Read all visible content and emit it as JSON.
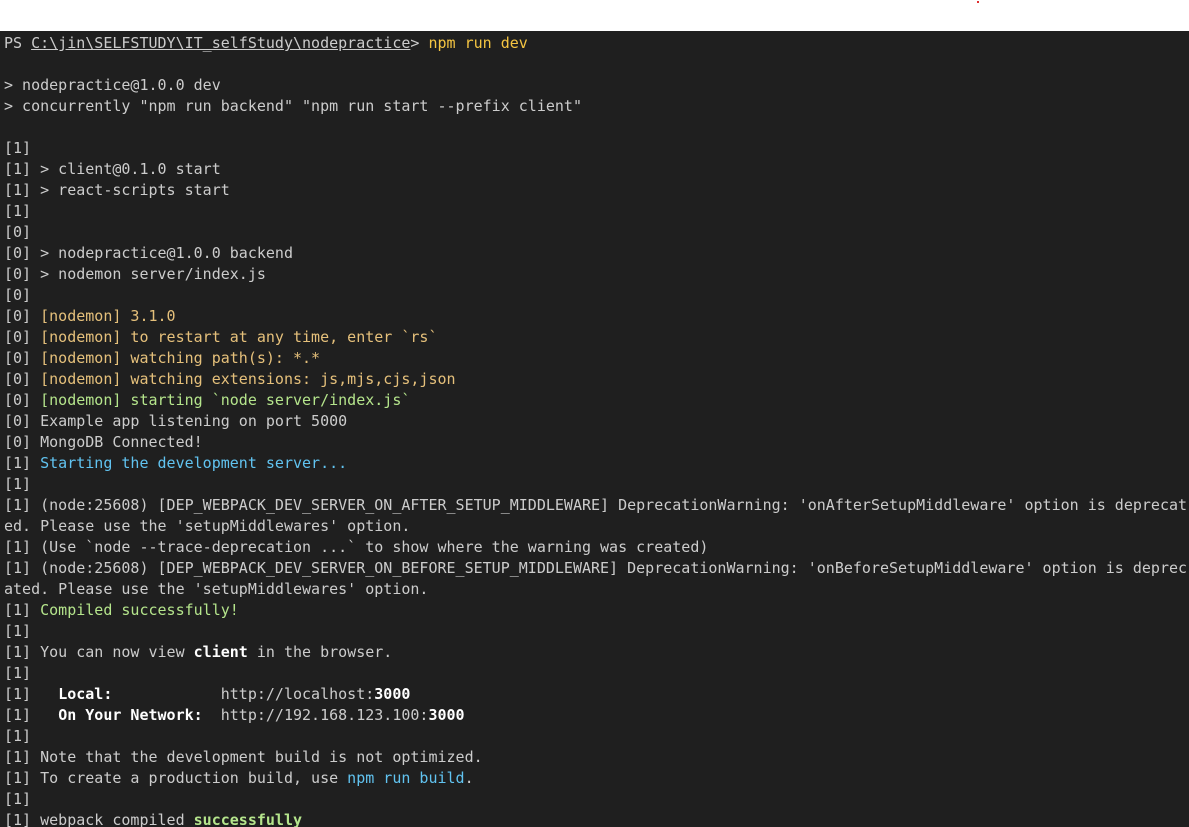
{
  "terminal": {
    "prompt_prefix": "PS ",
    "prompt_path": "C:\\jin\\SELFSTUDY\\IT_selfStudy\\nodepractice",
    "prompt_gt": "> ",
    "command": "npm run dev"
  },
  "lines": {
    "l1": "> nodepractice@1.0.0 dev",
    "l2": "> concurrently \"npm run backend\" \"npm run start --prefix client\"",
    "l3": "[1]",
    "l4": "[1] > client@0.1.0 start",
    "l5": "[1] > react-scripts start",
    "l6": "[1]",
    "l7": "[0]",
    "l8": "[0] > nodepractice@1.0.0 backend",
    "l9": "[0] > nodemon server/index.js",
    "l10": "[0]",
    "l11_pre": "[0] ",
    "l11_msg": "[nodemon] 3.1.0",
    "l12_pre": "[0] ",
    "l12_msg": "[nodemon] to restart at any time, enter `rs`",
    "l13_pre": "[0] ",
    "l13_msg": "[nodemon] watching path(s): *.*",
    "l14_pre": "[0] ",
    "l14_msg": "[nodemon] watching extensions: js,mjs,cjs,json",
    "l15_pre": "[0] ",
    "l15_msg": "[nodemon] starting `node server/index.js`",
    "l16": "[0] Example app listening on port 5000",
    "l17": "[0] MongoDB Connected!",
    "l18_pre": "[1] ",
    "l18_msg": "Starting the development server...",
    "l19": "[1]",
    "l20": "[1] (node:25608) [DEP_WEBPACK_DEV_SERVER_ON_AFTER_SETUP_MIDDLEWARE] DeprecationWarning: 'onAfterSetupMiddleware' option is deprecat",
    "l21": "ed. Please use the 'setupMiddlewares' option.",
    "l22": "[1] (Use `node --trace-deprecation ...` to show where the warning was created)",
    "l23": "[1] (node:25608) [DEP_WEBPACK_DEV_SERVER_ON_BEFORE_SETUP_MIDDLEWARE] DeprecationWarning: 'onBeforeSetupMiddleware' option is deprec",
    "l24": "ated. Please use the 'setupMiddlewares' option.",
    "l25_pre": "[1] ",
    "l25_msg": "Compiled successfully!",
    "l26": "[1]",
    "l27_pre": "[1] You can now view ",
    "l27_bold": "client",
    "l27_post": " in the browser.",
    "l28": "[1]",
    "l29_pre": "[1]   ",
    "l29_label": "Local:",
    "l29_gap": "            ",
    "l29_url": "http://localhost:",
    "l29_port": "3000",
    "l30_pre": "[1]   ",
    "l30_label": "On Your Network:",
    "l30_gap": "  ",
    "l30_url": "http://192.168.123.100:",
    "l30_port": "3000",
    "l31": "[1]",
    "l32": "[1] Note that the development build is not optimized.",
    "l33_pre": "[1] To create a production build, use ",
    "l33_cmd": "npm run build",
    "l33_post": ".",
    "l34": "[1]",
    "l35_pre": "[1] webpack compiled ",
    "l35_bold": "successfully"
  },
  "colors": {
    "background": "#1f1f1f",
    "text": "#cccccc",
    "nodemon_yellow": "#e5c07b",
    "success_green": "#b5e58c",
    "info_cyan": "#61c3f0"
  }
}
